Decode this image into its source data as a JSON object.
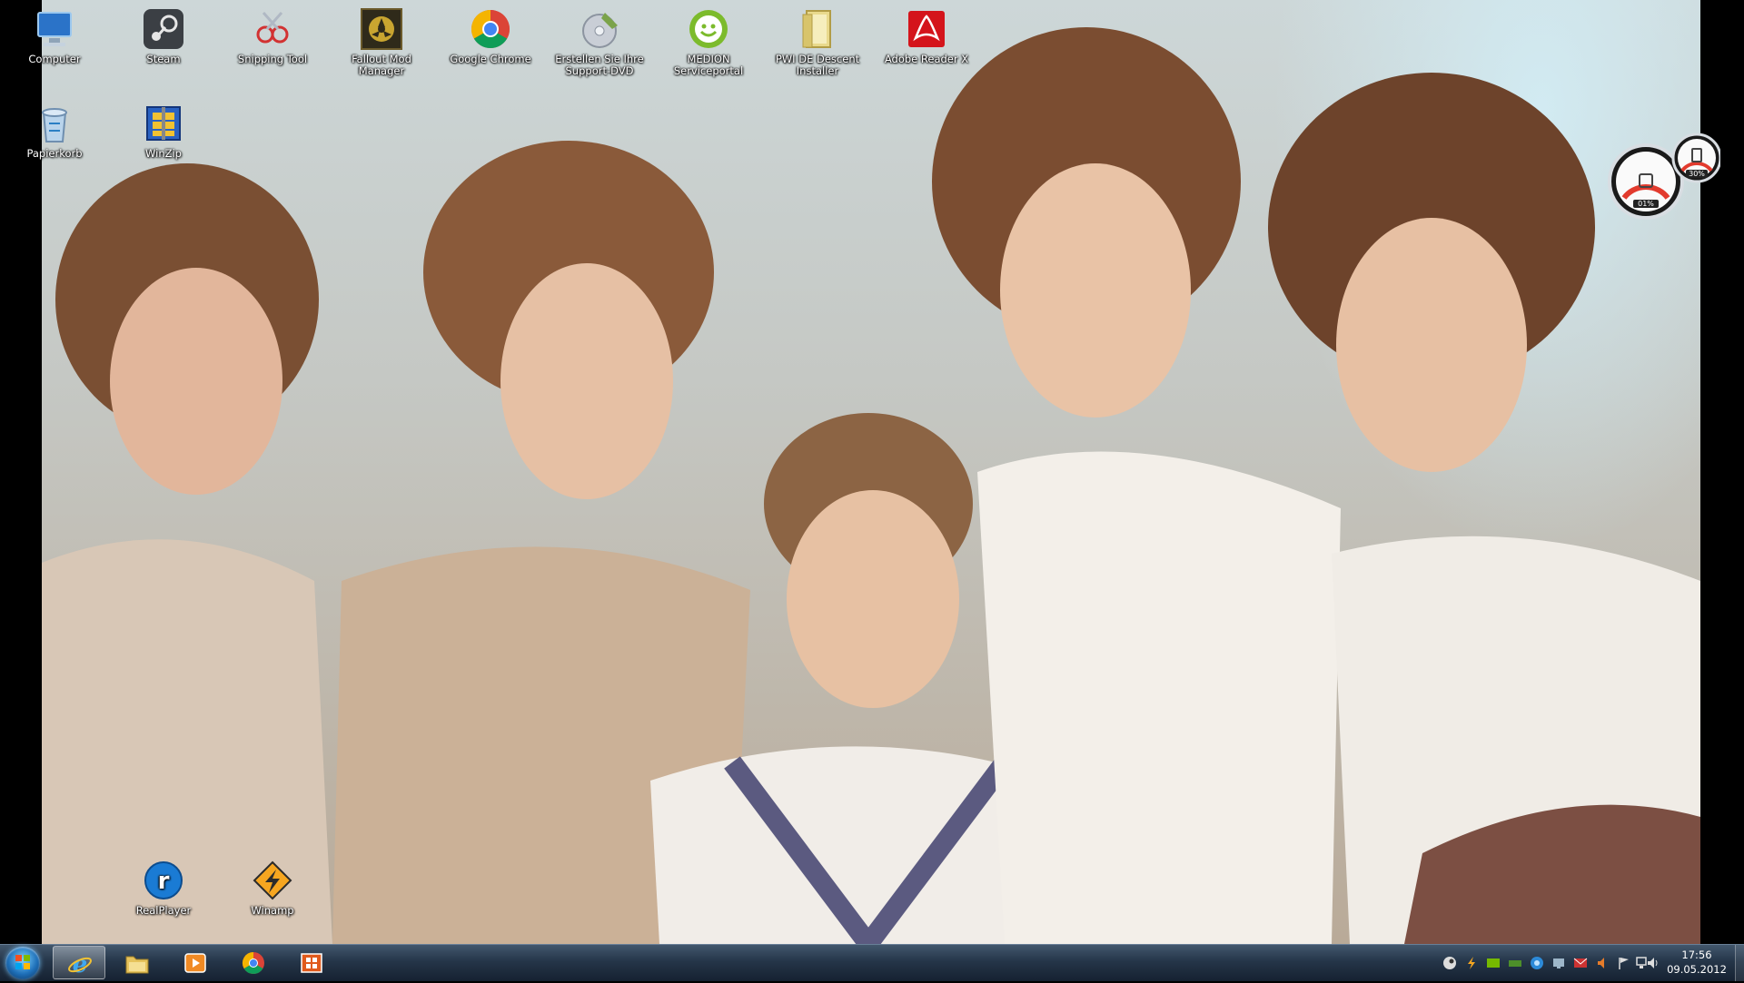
{
  "desktop": {
    "icons": [
      {
        "label": "Computer",
        "icon": "computer-icon"
      },
      {
        "label": "Steam",
        "icon": "steam-icon"
      },
      {
        "label": "Snipping Tool",
        "icon": "snipping-tool-icon"
      },
      {
        "label": "Fallout Mod Manager",
        "icon": "fallout-mod-manager-icon"
      },
      {
        "label": "Google Chrome",
        "icon": "chrome-icon"
      },
      {
        "label": "Erstellen Sie Ihre Support-DVD",
        "icon": "support-dvd-icon"
      },
      {
        "label": "MEDION Serviceportal",
        "icon": "medion-icon"
      },
      {
        "label": "PWI DE Descent Installer",
        "icon": "folder-icon"
      },
      {
        "label": "Adobe Reader X",
        "icon": "adobe-reader-icon"
      },
      {
        "label": "Papierkorb",
        "icon": "recycle-bin-icon"
      },
      {
        "label": "WinZip",
        "icon": "winzip-icon"
      },
      {
        "label": "RealPlayer",
        "icon": "realplayer-icon"
      },
      {
        "label": "Winamp",
        "icon": "winamp-icon"
      }
    ]
  },
  "gadget": {
    "cpu_percent": "01%",
    "memory_percent": "30%"
  },
  "taskbar": {
    "pinned": [
      {
        "name": "Internet Explorer",
        "icon": "internet-explorer-icon"
      },
      {
        "name": "Windows Explorer",
        "icon": "explorer-folder-icon"
      },
      {
        "name": "Windows Media Player",
        "icon": "media-player-icon"
      },
      {
        "name": "Google Chrome",
        "icon": "chrome-icon"
      },
      {
        "name": "Windows Office",
        "icon": "office-icon"
      }
    ],
    "clock": {
      "time": "17:56",
      "date": "09.05.2012"
    }
  },
  "colors": {
    "taskbar": "#263a50",
    "accent": "#3a9fe0"
  }
}
